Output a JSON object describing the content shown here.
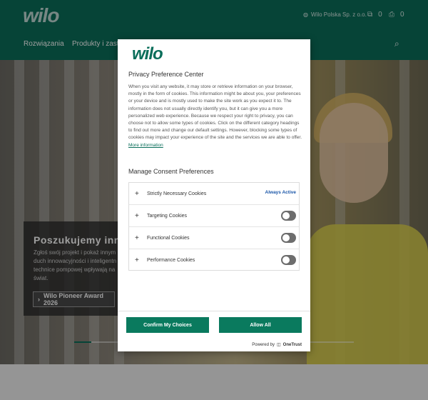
{
  "header": {
    "logo": "wilo",
    "company": "Wilo Polska Sp. z o.o.",
    "compare_count": "0",
    "cart_count": "0",
    "nav": [
      "Rozwiązania",
      "Produkty i zast"
    ]
  },
  "hero": {
    "title": "Poszukujemy inno",
    "description": "Zgłoś swój projekt i pokaż innym duch innowacyjności i inteligentn technice pompowej wpływają na świat.",
    "button_label": "Wilo Pioneer Award 2026",
    "slider_progress": 0.06
  },
  "modal": {
    "logo": "wilo",
    "title": "Privacy Preference Center",
    "description": "When you visit any website, it may store or retrieve information on your browser, mostly in the form of cookies. This information might be about you, your preferences or your device and is mostly used to make the site work as you expect it to. The information does not usually directly identify you, but it can give you a more personalized web experience. Because we respect your right to privacy, you can choose not to allow some types of cookies. Click on the different category headings to find out more and change our default settings. However, blocking some types of cookies may impact your experience of the site and the services we are able to offer.",
    "more_info": "More information",
    "consent_title": "Manage Consent Preferences",
    "categories": [
      {
        "label": "Strictly Necessary Cookies",
        "status": "Always Active"
      },
      {
        "label": "Targeting Cookies",
        "status": "off"
      },
      {
        "label": "Functional Cookies",
        "status": "off"
      },
      {
        "label": "Performance Cookies",
        "status": "off"
      }
    ],
    "confirm_label": "Confirm My Choices",
    "allow_all_label": "Allow All",
    "powered_by": "Powered by",
    "powered_brand": "OneTrust"
  },
  "colors": {
    "brand": "#0a6e5a",
    "button": "#0a7a5e",
    "link": "#1a56a8"
  }
}
